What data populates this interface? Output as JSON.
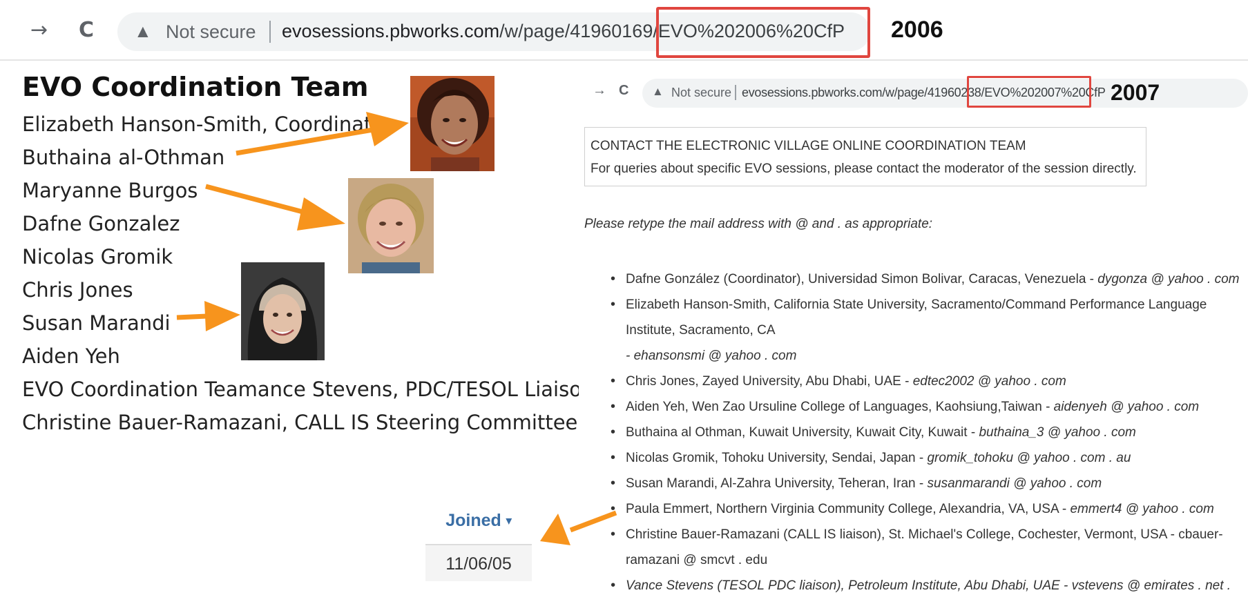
{
  "browser_2006": {
    "back_glyph": "→",
    "reload_glyph": "C",
    "warning_glyph": "▲",
    "not_secure": "Not secure",
    "url_host": "evosessions.pbworks.com",
    "url_path": "/w/page/41960169/EVO%202006%20CfP",
    "year_label": "2006"
  },
  "team_2006": {
    "title": "EVO Coordination Team",
    "members": [
      "Elizabeth Hanson-Smith, Coordinator",
      "Buthaina al-Othman",
      "Maryanne Burgos",
      "Dafne Gonzalez",
      "Nicolas Gromik",
      "Chris Jones",
      "Susan Marandi",
      "Aiden Yeh",
      "EVO Coordination Teamance Stevens, PDC/TESOL Liaison",
      "Christine Bauer-Ramazani, CALL IS Steering Committee Liaison"
    ]
  },
  "joined": {
    "header": "Joined",
    "caret": "▾",
    "date": "11/06/05"
  },
  "browser_2007": {
    "back_glyph": "→",
    "reload_glyph": "C",
    "warning_glyph": "▲",
    "not_secure": "Not secure",
    "url_host": "evosessions.pbworks.com",
    "url_path": "/w/page/41960238/EVO%202007%20CfP",
    "year_label": "2007"
  },
  "contact_box": {
    "line1": "CONTACT THE ELECTRONIC VILLAGE ONLINE COORDINATION TEAM",
    "line2": "For queries about specific EVO sessions, please contact the moderator of the session directly."
  },
  "retype_note": "Please retype the mail address with @ and . as appropriate:",
  "members_2007": [
    {
      "text": "Dafne González (Coordinator), Universidad Simon Bolivar, Caracas, Venezuela - ",
      "email": "dygonza @ yahoo . com"
    },
    {
      "text": "Elizabeth Hanson-Smith, California State University, Sacramento/Command Performance Language Institute, Sacramento, CA",
      "email": "- ehansonsmi @ yahoo . com"
    },
    {
      "text": "Chris Jones, Zayed University, Abu Dhabi, UAE - ",
      "email": "edtec2002 @ yahoo . com"
    },
    {
      "text": "Aiden Yeh, Wen Zao Ursuline College of Languages, Kaohsiung,Taiwan - ",
      "email": "aidenyeh @ yahoo . com"
    },
    {
      "text": "Buthaina al Othman, Kuwait University, Kuwait City, Kuwait - ",
      "email": "buthaina_3 @ yahoo . com"
    },
    {
      "text": "Nicolas Gromik, Tohoku University, Sendai, Japan - ",
      "email": "gromik_tohoku @ yahoo . com . au"
    },
    {
      "text": "Susan Marandi, Al-Zahra University, Teheran, Iran - ",
      "email": "susanmarandi @ yahoo . com"
    },
    {
      "text": "Paula Emmert, Northern Virginia Community College, Alexandria, VA, USA - ",
      "email": "emmert4 @ yahoo . com"
    },
    {
      "text": "Christine Bauer-Ramazani (CALL IS liaison), St. Michael's College, Cochester, Vermont, USA - cbauer-ramazani @ smcvt . edu",
      "email": ""
    },
    {
      "text": "Vance Stevens (TESOL PDC liaison), Petroleum Institute, Abu Dhabi, UAE - vstevens @ emirates . net . ae",
      "email": ""
    }
  ],
  "colors": {
    "arrow": "#f7941d",
    "highlight_box": "#e0463f",
    "joined_header": "#3a6ea5"
  }
}
